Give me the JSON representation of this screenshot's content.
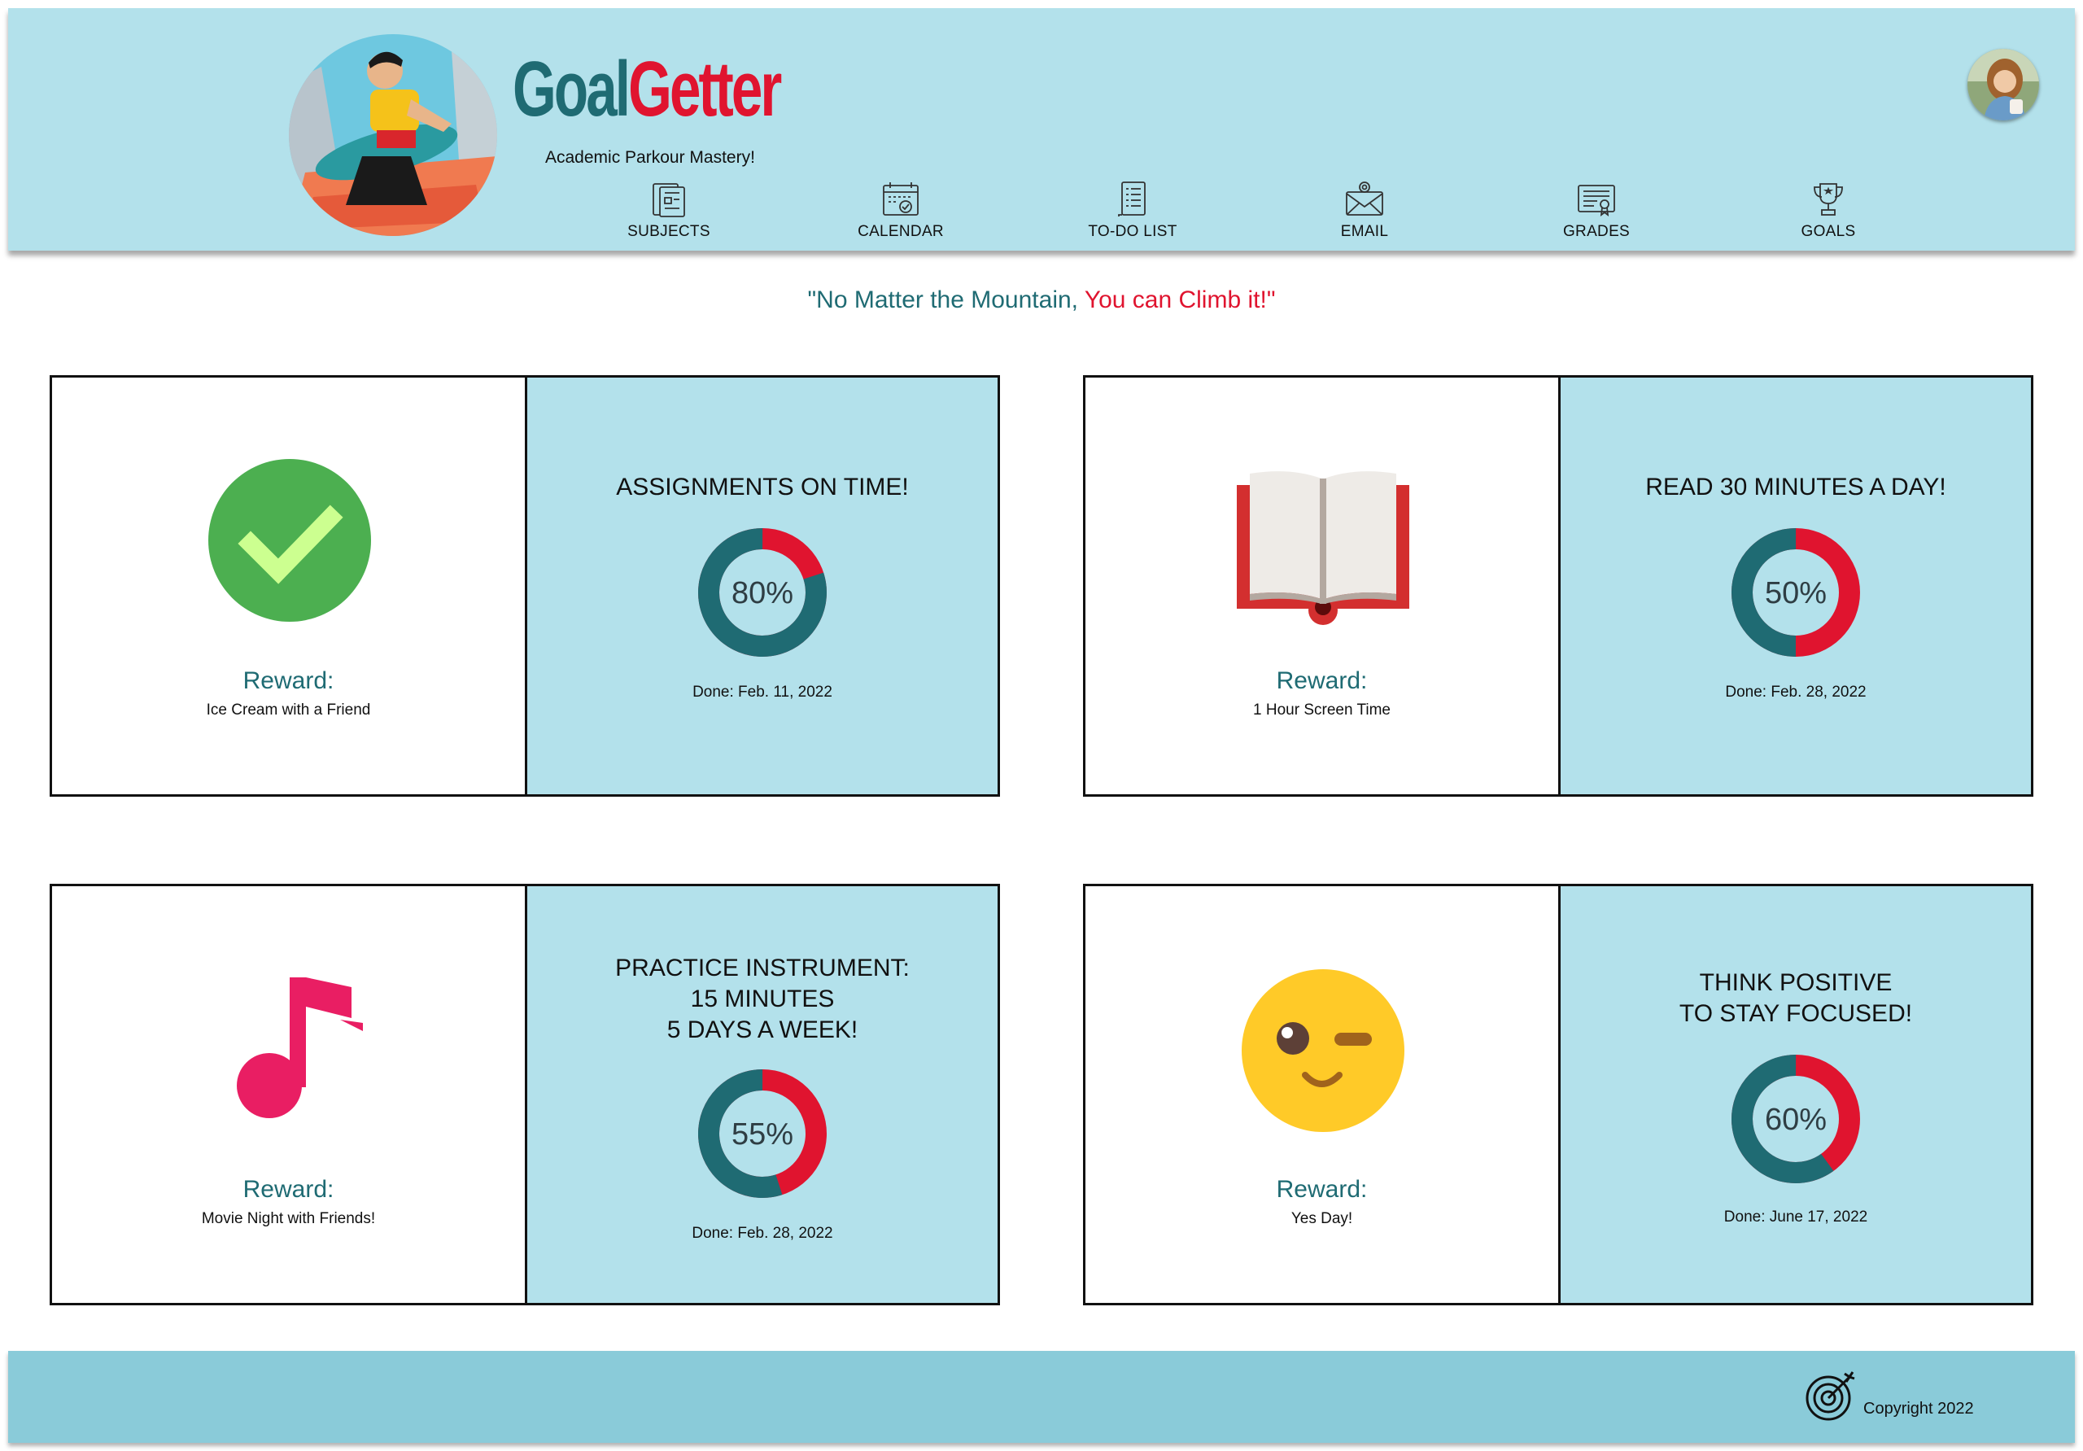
{
  "brand": {
    "part1": "Goal",
    "part2": "Getter",
    "tagline": "Academic Parkour Mastery!"
  },
  "nav": [
    {
      "label": "SUBJECTS",
      "icon": "subjects-icon"
    },
    {
      "label": "CALENDAR",
      "icon": "calendar-icon"
    },
    {
      "label": "TO-DO LIST",
      "icon": "todo-list-icon"
    },
    {
      "label": "EMAIL",
      "icon": "email-icon"
    },
    {
      "label": "GRADES",
      "icon": "grades-icon"
    },
    {
      "label": "GOALS",
      "icon": "goals-icon"
    }
  ],
  "quote": {
    "part1": "\"No Matter the Mountain, ",
    "part2": "You can Climb it!\""
  },
  "goals": [
    {
      "title_lines": [
        "ASSIGNMENTS ON TIME!"
      ],
      "percent": 80,
      "percent_label": "80%",
      "done": "Done: Feb. 11, 2022",
      "reward_label": "Reward:",
      "reward": "Ice Cream with a Friend",
      "icon": "checkmark-icon"
    },
    {
      "title_lines": [
        "READ 30 MINUTES A DAY!"
      ],
      "percent": 50,
      "percent_label": "50%",
      "done": "Done: Feb. 28, 2022",
      "reward_label": "Reward:",
      "reward": "1 Hour Screen Time",
      "icon": "open-book-icon"
    },
    {
      "title_lines": [
        "PRACTICE INSTRUMENT:",
        "15 MINUTES",
        "5 DAYS A WEEK!"
      ],
      "percent": 55,
      "percent_label": "55%",
      "done": "Done: Feb. 28, 2022",
      "reward_label": "Reward:",
      "reward": "Movie Night with Friends!",
      "icon": "music-note-icon"
    },
    {
      "title_lines": [
        "THINK POSITIVE",
        "TO STAY FOCUSED!"
      ],
      "percent": 60,
      "percent_label": "60%",
      "done": "Done: June 17, 2022",
      "reward_label": "Reward:",
      "reward": "Yes Day!",
      "icon": "winking-face-icon"
    }
  ],
  "footer": {
    "copyright": "Copyright 2022"
  },
  "colors": {
    "teal": "#1f6b73",
    "red": "#e0142f",
    "header_bg": "#b3e1eb",
    "footer_bg": "#8acbd9"
  }
}
